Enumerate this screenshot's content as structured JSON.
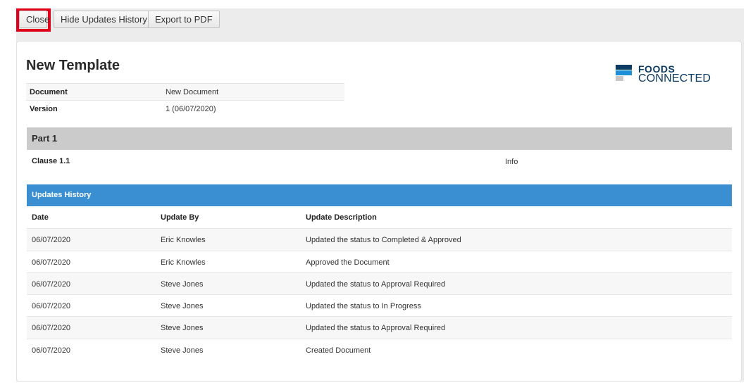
{
  "toolbar": {
    "close_label": "Close",
    "hide_history_label": "Hide Updates History",
    "export_label": "Export to PDF",
    "highlight_color": "#e0001b"
  },
  "document": {
    "title": "New Template",
    "meta": [
      {
        "label": "Document",
        "value": "New Document"
      },
      {
        "label": "Version",
        "value": "1 (06/07/2020)"
      }
    ]
  },
  "logo": {
    "line1": "FOODS",
    "line2": "CONNECTED",
    "colors": [
      "#0b3a63",
      "#1d8fd6",
      "#c6c6c6"
    ]
  },
  "part": {
    "title": "Part 1",
    "clause_label": "Clause 1.1",
    "clause_value": "Info"
  },
  "updates": {
    "header": "Updates History",
    "header_color": "#3a8fd3",
    "columns": [
      "Date",
      "Update By",
      "Update Description"
    ],
    "rows": [
      {
        "date": "06/07/2020",
        "by": "Eric Knowles",
        "desc": "Updated the status to Completed & Approved"
      },
      {
        "date": "06/07/2020",
        "by": "Eric Knowles",
        "desc": "Approved the Document"
      },
      {
        "date": "06/07/2020",
        "by": "Steve Jones",
        "desc": "Updated the status to Approval Required"
      },
      {
        "date": "06/07/2020",
        "by": "Steve Jones",
        "desc": "Updated the status to In Progress"
      },
      {
        "date": "06/07/2020",
        "by": "Steve Jones",
        "desc": "Updated the status to Approval Required"
      },
      {
        "date": "06/07/2020",
        "by": "Steve Jones",
        "desc": "Created Document"
      }
    ]
  }
}
